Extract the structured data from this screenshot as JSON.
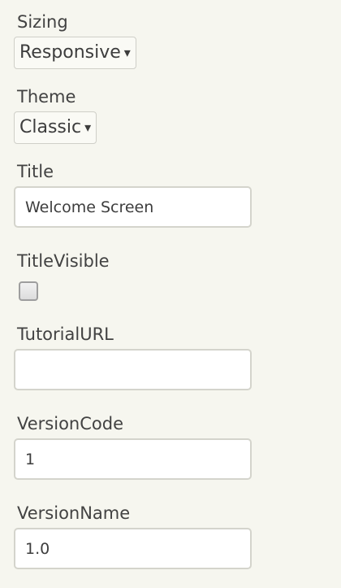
{
  "properties": {
    "sizing": {
      "label": "Sizing",
      "selected": "Responsive",
      "caret": "▾"
    },
    "theme": {
      "label": "Theme",
      "selected": "Classic",
      "caret": "▾"
    },
    "title": {
      "label": "Title",
      "value": "Welcome Screen"
    },
    "title_visible": {
      "label": "TitleVisible",
      "checked": false
    },
    "tutorial_url": {
      "label": "TutorialURL",
      "value": ""
    },
    "version_code": {
      "label": "VersionCode",
      "value": "1"
    },
    "version_name": {
      "label": "VersionName",
      "value": "1.0"
    }
  }
}
